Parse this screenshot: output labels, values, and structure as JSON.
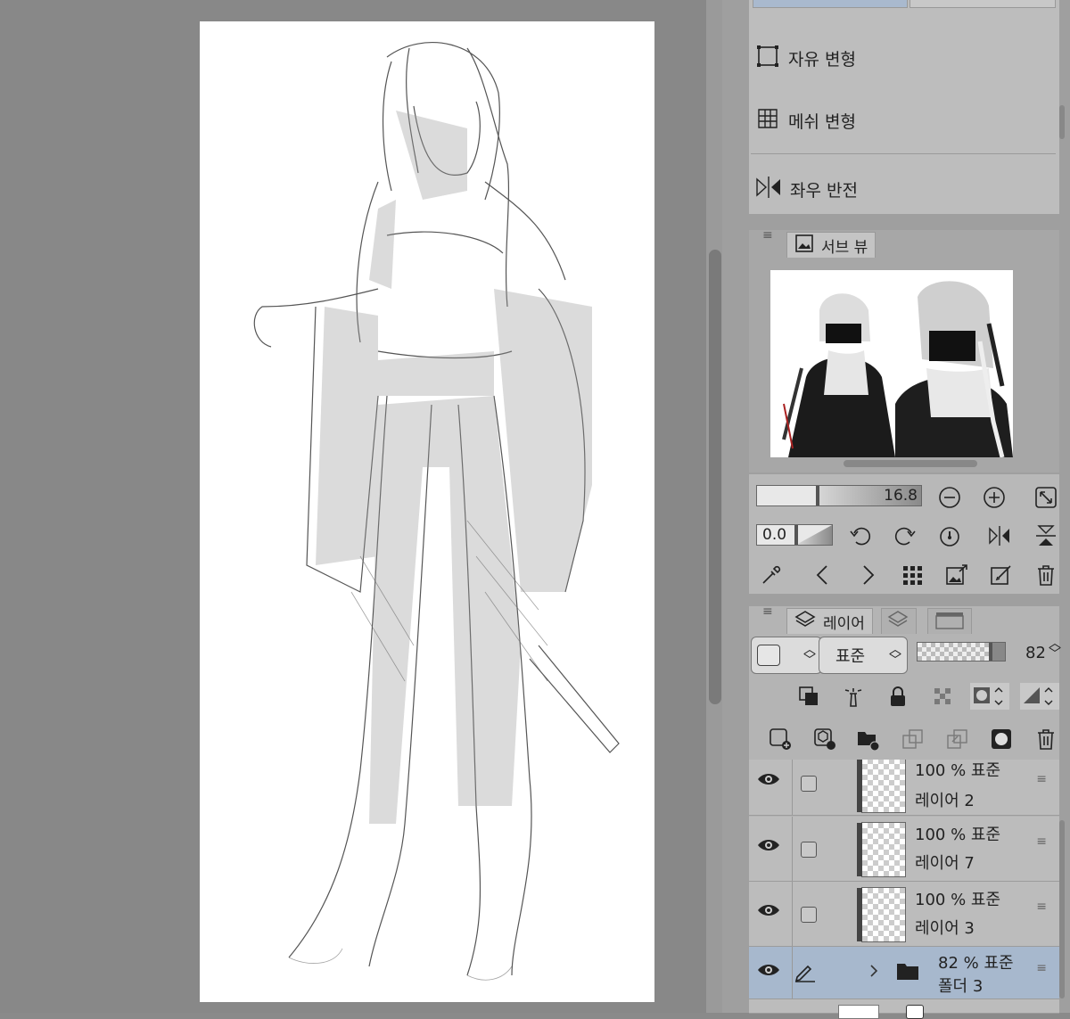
{
  "transform_menu": {
    "items": [
      {
        "label": "자유 변형",
        "icon": "free-transform-icon"
      },
      {
        "label": "메쉬 변형",
        "icon": "mesh-transform-icon"
      },
      {
        "label": "좌우 반전",
        "icon": "flip-horizontal-icon"
      }
    ]
  },
  "subview": {
    "tab_label": "서브 뷰",
    "icon": "image-icon"
  },
  "navigator": {
    "zoom_value": "16.8",
    "rotation_value": "0.0"
  },
  "layers": {
    "tab_label": "레이어",
    "blend_mode": "표준",
    "opacity": "82",
    "rows": [
      {
        "opacity_mode": "100 % 표준",
        "name": "레이어 2"
      },
      {
        "opacity_mode": "100 % 표준",
        "name": "레이어 7"
      },
      {
        "opacity_mode": "100 % 표준",
        "name": "레이어 3"
      },
      {
        "opacity_mode": "82 % 표준",
        "name": "폴더 3",
        "selected": true,
        "folder": true
      }
    ]
  },
  "colors": {
    "selected_row": "#a7b8cd",
    "panel_bg": "#b4b4b4",
    "workspace_bg": "#888888"
  }
}
